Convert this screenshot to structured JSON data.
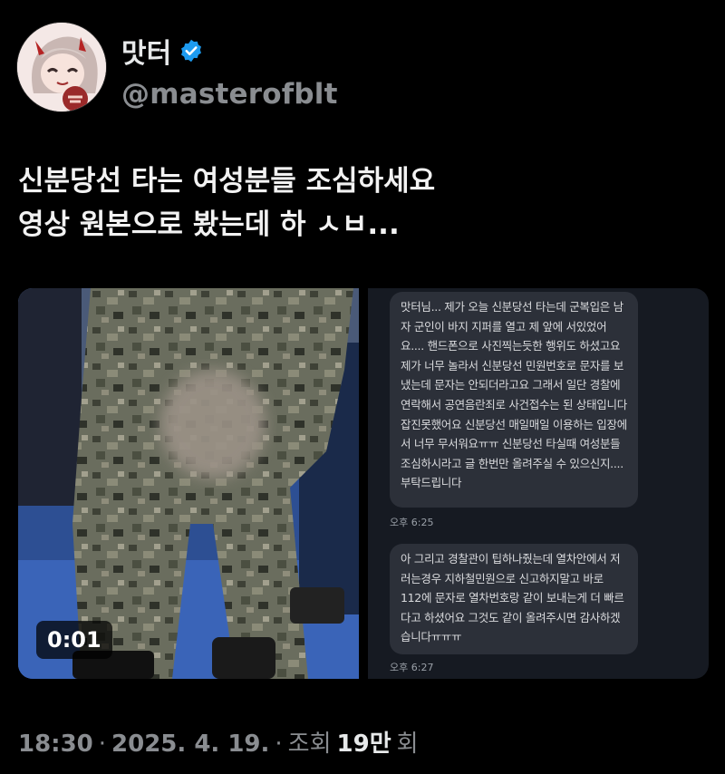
{
  "author": {
    "display_name": "맛터",
    "handle": "@masterofblt",
    "verified": true,
    "verified_color": "#1d9bf0",
    "avatar_icon": "anime-avatar-icon"
  },
  "tweet": {
    "line1": "신분당선 타는 여성분들 조심하세요",
    "line2": "영상 원본으로 봤는데 하 ㅅㅂ..."
  },
  "media": {
    "video_time": "0:01",
    "chat": {
      "message1": "맛터님... 제가 오늘 신분당선 타는데 군복입은 남자 군인이 바지 지퍼를 열고 제 앞에 서있었어요.... 핸드폰으로 사진찍는듯한 행위도 하셨고요 제가 너무 놀라서 신분당선 민원번호로 문자를 보냈는데 문자는 안되더라고요 그래서 일단 경찰에 연락해서 공연음란죄로 사건접수는 된 상태입니다 잡진못했어요 신분당선 매일매일 이용하는 입장에서 너무 무서워요ㅠㅠ 신분당선 타실때 여성분들 조심하시라고 글 한번만 올려주실 수 있으신지....부탁드립니다",
      "time1": "오후 6:25",
      "message2": "아 그리고 경찰관이 팁하나줬는데 열차안에서 저러는경우 지하철민원으로 신고하지말고 바로 112에 문자로 열차번호랑 같이 보내는게 더 빠르다고 하셨어요 그것도 같이 올려주시면 감사하겠습니다ㅠㅠㅠ",
      "time2": "오후 6:27"
    }
  },
  "footer": {
    "time": "18:30",
    "sep1": "·",
    "date": "2025. 4. 19.",
    "sep2": "·",
    "views_prefix": "조회",
    "views_count": "19만",
    "views_suffix": "회"
  }
}
